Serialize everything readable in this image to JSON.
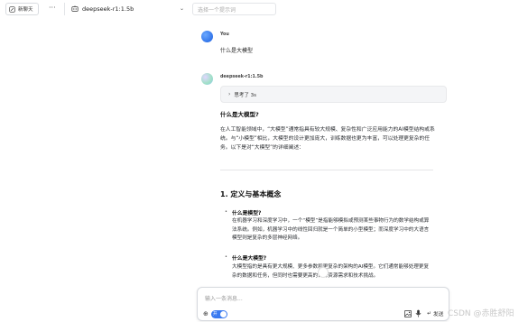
{
  "topbar": {
    "new_chat_label": "新聊天",
    "more_label": "···",
    "model_name": "deepseek-r1:1.5b",
    "prompt_placeholder": "选择一个提示词"
  },
  "user_message": {
    "sender": "You",
    "text": "什么是大模型"
  },
  "bot_message": {
    "sender": "deepseek-r1:1.5b",
    "thinking_label": "思考了 3s",
    "heading1": "什么是大模型?",
    "intro": "在人工智能领域中，“大模型”通常指具有较大规模、复杂性和广泛应用能力的AI模型结构或系统。与“小模型”相比，大模型的设计更加庞大，训练数据也更为丰富，可以处理更复杂的任务。以下是对“大模型”的详细阐述：",
    "section_title": "1. 定义与基本概念",
    "items": [
      {
        "title": "什么是模型?",
        "body": "在机器学习和深度学习中，一个“模型”是指能够模拟或预测某些事物行为的数学结构或算法系统。例如，机器学习中的线性回归就是一个简单的小型模型；而深度学习中的大语言模型则是复杂的多层神经网络。"
      },
      {
        "title": "什么是大模型?",
        "body": "大模型指的是具有更大规模、更多参数和更复杂的架构的AI模型。它们通常能够处理更复杂的数据和任务，但同时也需要更高的计算资源需求和技术挑战。"
      }
    ]
  },
  "input": {
    "placeholder": "输入一条消息...",
    "toggle_label": "开",
    "send_label": "发送"
  },
  "watermark": "CSDN @赤胜舒阳"
}
